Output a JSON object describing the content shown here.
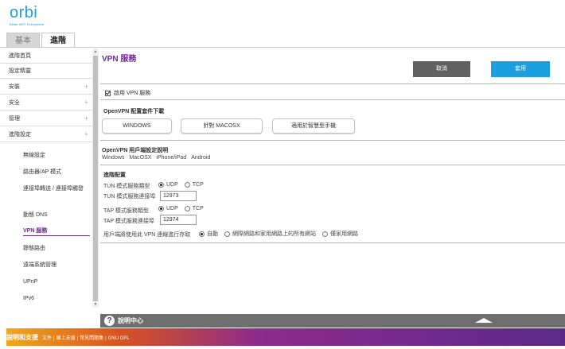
{
  "brand": {
    "logo_text": "orbi",
    "tagline": "Better WiFi. Everywhere."
  },
  "tabs": [
    {
      "label": "基本"
    },
    {
      "label": "進階"
    }
  ],
  "sidebar": {
    "items": [
      {
        "label": "進階首頁"
      },
      {
        "label": "設定精靈"
      },
      {
        "label": "安裝",
        "expander": "+"
      },
      {
        "label": "安全",
        "expander": "+"
      },
      {
        "label": "管理",
        "expander": "+"
      },
      {
        "label": "進階設定",
        "expander": "+"
      }
    ],
    "sub_items": [
      {
        "label": "無線設定"
      },
      {
        "label": "路由器/AP 模式"
      },
      {
        "label": "連接埠轉送 / 連接埠觸發"
      },
      {
        "label": "動態 DNS"
      },
      {
        "label": "VPN 服務"
      },
      {
        "label": "靜態路由"
      },
      {
        "label": "遠端系統管理"
      },
      {
        "label": "UPnP"
      },
      {
        "label": "IPv6"
      }
    ],
    "active_sub_item": "VPN 服務"
  },
  "main": {
    "title": "VPN 服務",
    "cancel_label": "取消",
    "apply_label": "套用",
    "enable_vpn_label": "啟用 VPN 服務",
    "enable_vpn_checked": true,
    "download": {
      "title": "OpenVPN 配置套件下載",
      "buttons": [
        {
          "label": "WINDOWS"
        },
        {
          "label": "針對 MACOSX"
        },
        {
          "label": "適用於智慧型手機"
        }
      ]
    },
    "user_guide": {
      "title": "OpenVPN 用戶端設定說明",
      "links": [
        {
          "label": "Windows"
        },
        {
          "label": "MacOSX"
        },
        {
          "label": "iPhone/iPad"
        },
        {
          "label": "Android"
        }
      ]
    },
    "advanced": {
      "title": "進階配置",
      "tun_service_type_label": "TUN 模式服務類型",
      "tun_udp_label": "UDP",
      "tun_tcp_label": "TCP",
      "tun_selected": "UDP",
      "tun_port_label": "TUN 模式服務連接埠",
      "tun_port_value": "12973",
      "tap_service_type_label": "TAP 模式服務類型",
      "tap_udp_label": "UDP",
      "tap_tcp_label": "TCP",
      "tap_selected": "UDP",
      "tap_port_label": "TAP 模式服務連接埠",
      "tap_port_value": "12974",
      "client_access_label": "用戶端將使用此 VPN 連線進行存取",
      "access_options": [
        {
          "label": "自動"
        },
        {
          "label": "網際網路和家用網路上的所有網站"
        },
        {
          "label": "僅家用網路"
        }
      ],
      "access_selected": "自動"
    }
  },
  "help_bar": {
    "icon": "?",
    "label": "說明中心"
  },
  "footer": {
    "title": "說明和支援",
    "links": [
      {
        "label": "文件"
      },
      {
        "label": "線上支援"
      },
      {
        "label": "常見問題集"
      },
      {
        "label": "GNU GPL"
      }
    ],
    "separator": "|"
  },
  "colors": {
    "brand_blue": "#1aa0d8",
    "accent_purple": "#6a2c91",
    "apply_blue": "#1a9fe0",
    "cancel_gray": "#616161"
  }
}
